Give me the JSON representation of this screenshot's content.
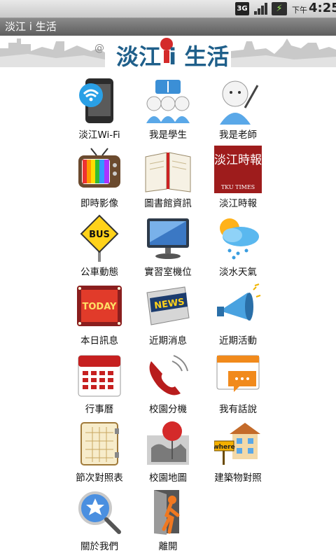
{
  "status_bar": {
    "network": "3G",
    "ampm": "下午",
    "time": "4:25"
  },
  "window": {
    "title": "淡江 i 生活"
  },
  "banner": {
    "title": "淡江 i 生活"
  },
  "menu": [
    {
      "label": "淡江Wi-Fi",
      "icon": "wifi-phone-icon"
    },
    {
      "label": "我是學生",
      "icon": "students-icon"
    },
    {
      "label": "我是老師",
      "icon": "teacher-icon"
    },
    {
      "label": "即時影像",
      "icon": "tv-icon"
    },
    {
      "label": "圖書館資訊",
      "icon": "book-icon"
    },
    {
      "label": "淡江時報",
      "icon": "newspaper-logo-icon",
      "logo_text": "淡江時報",
      "logo_sub": "TKU TIMES"
    },
    {
      "label": "公車動態",
      "icon": "bus-sign-icon",
      "sign_text": "BUS"
    },
    {
      "label": "實習室機位",
      "icon": "monitor-icon"
    },
    {
      "label": "淡水天氣",
      "icon": "weather-icon"
    },
    {
      "label": "本日訊息",
      "icon": "today-icon",
      "sign_text": "TODAY"
    },
    {
      "label": "近期消息",
      "icon": "news-icon",
      "sign_text": "NEWS"
    },
    {
      "label": "近期活動",
      "icon": "megaphone-icon"
    },
    {
      "label": "行事曆",
      "icon": "calendar-icon"
    },
    {
      "label": "校園分機",
      "icon": "telephone-icon"
    },
    {
      "label": "我有話說",
      "icon": "chat-icon"
    },
    {
      "label": "節次對照表",
      "icon": "notebook-icon"
    },
    {
      "label": "校園地圖",
      "icon": "map-pin-icon"
    },
    {
      "label": "建築物對照",
      "icon": "building-icon",
      "sign_text": "where"
    },
    {
      "label": "關於我們",
      "icon": "about-magnifier-icon"
    },
    {
      "label": "離開",
      "icon": "exit-door-icon"
    }
  ],
  "colors": {
    "title_bar": "#6e6e6e",
    "brand_blue": "#1f5f8a",
    "brand_red": "#d42a2a"
  }
}
